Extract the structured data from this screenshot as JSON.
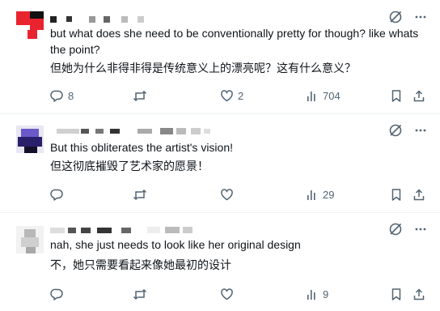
{
  "colors": {
    "text": "#0f1419",
    "secondary": "#536471",
    "divider": "#eff3f4",
    "background": "#ffffff"
  },
  "icons": {
    "grok": "grok-icon",
    "more": "more-icon",
    "reply": "reply-icon",
    "retweet": "retweet-icon",
    "like": "like-icon",
    "views": "views-icon",
    "bookmark": "bookmark-icon",
    "share": "share-icon"
  },
  "tweets": [
    {
      "text_en_1": "but what does she need to be conventionally pretty for though? like whats",
      "text_en_2": "the point?",
      "text_cn": "但她为什么非得非得是传统意义上的漂亮呢？这有什么意义？",
      "replies": "8",
      "retweets": "",
      "likes": "2",
      "views": "704"
    },
    {
      "text_en_1": "But this obliterates the artist's vision!",
      "text_cn": "但这彻底摧毁了艺术家的愿景！",
      "replies": "",
      "retweets": "",
      "likes": "",
      "views": "29"
    },
    {
      "text_en_1": "nah, she just needs to look like her original design",
      "text_cn": "不，她只需要看起来像她最初的设计",
      "replies": "",
      "retweets": "",
      "likes": "",
      "views": "9"
    }
  ]
}
